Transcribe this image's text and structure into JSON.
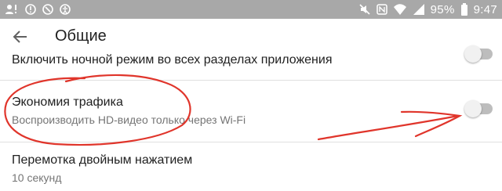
{
  "status_bar": {
    "battery": "95%",
    "time": "9:47",
    "icons": [
      "account-alert-icon",
      "alert-icon",
      "no-sync-icon",
      "accessibility-icon",
      "mute-icon",
      "nfc-icon",
      "wifi-icon",
      "signal-icon",
      "battery-icon"
    ]
  },
  "header": {
    "title": "Общие",
    "back_icon": "arrow-back-icon"
  },
  "settings": [
    {
      "title": "Включить ночной режим во всех разделах приложения",
      "enabled": false
    },
    {
      "title": "Экономия трафика",
      "subtitle": "Воспроизводить HD-видео только через Wi-Fi",
      "enabled": false
    },
    {
      "title": "Перемотка двойным нажатием",
      "subtitle": "10 секунд"
    }
  ],
  "annotation_color": "#e0352b",
  "colors": {
    "status_bar_bg": "#a8a8a8",
    "text_primary": "#212121",
    "text_secondary": "#757575"
  }
}
